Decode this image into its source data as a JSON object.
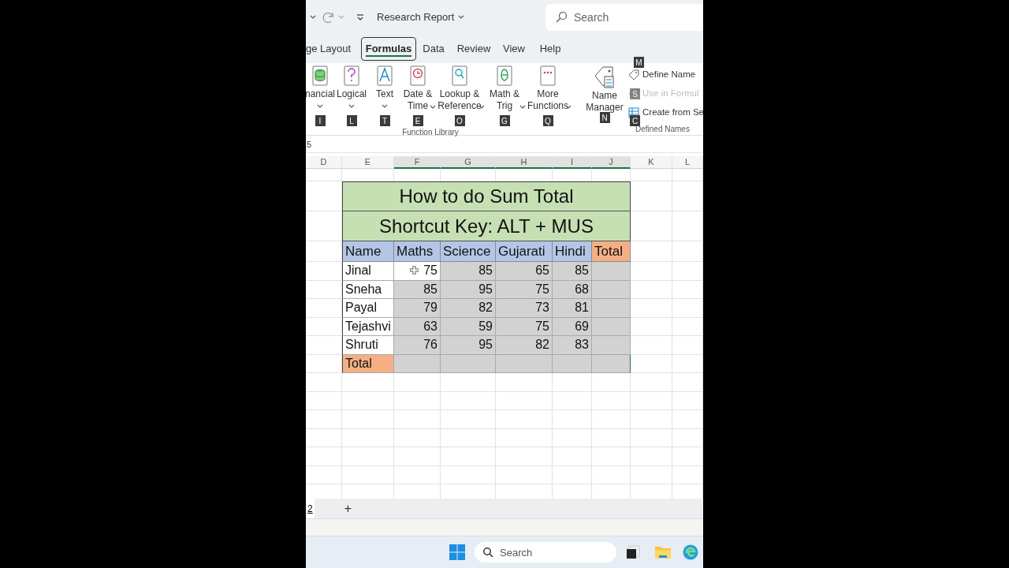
{
  "title_bar": {
    "title": "Research Report",
    "search_placeholder": "Search"
  },
  "tabs": [
    {
      "label": "ge Layout",
      "selected": false
    },
    {
      "label": "Formulas",
      "selected": true
    },
    {
      "label": "Data",
      "selected": false
    },
    {
      "label": "Review",
      "selected": false
    },
    {
      "label": "View",
      "selected": false
    },
    {
      "label": "Help",
      "selected": false
    }
  ],
  "ribbon": {
    "function_library": {
      "label": "Function Library",
      "buttons": [
        {
          "lines": [
            "nancial"
          ],
          "keytip": "I"
        },
        {
          "lines": [
            "Logical"
          ],
          "keytip": "L"
        },
        {
          "lines": [
            "Text"
          ],
          "keytip": "T"
        },
        {
          "lines": [
            "Date &",
            "Time"
          ],
          "keytip": "E"
        },
        {
          "lines": [
            "Lookup &",
            "Reference"
          ],
          "keytip": "O"
        },
        {
          "lines": [
            "Math &",
            "Trig"
          ],
          "keytip": "G"
        },
        {
          "lines": [
            "More",
            "Functions"
          ],
          "keytip": "Q"
        }
      ]
    },
    "defined_names": {
      "label": "Defined Names",
      "name_manager": {
        "lines": [
          "Name",
          "Manager"
        ],
        "keytip": "N"
      },
      "small_buttons": [
        {
          "label": "Define Name",
          "keytip": "M",
          "disabled": false
        },
        {
          "label": "Use in Formul",
          "keytip": "S",
          "disabled": true
        },
        {
          "label": "Create from Se",
          "keytip": "C",
          "disabled": false
        }
      ]
    }
  },
  "formula_bar": {
    "text": "5"
  },
  "columns": [
    {
      "label": "D",
      "selected": false
    },
    {
      "label": "E",
      "selected": false
    },
    {
      "label": "F",
      "selected": true
    },
    {
      "label": "G",
      "selected": true
    },
    {
      "label": "H",
      "selected": true
    },
    {
      "label": "I",
      "selected": true
    },
    {
      "label": "J",
      "selected": true
    },
    {
      "label": "K",
      "selected": false
    },
    {
      "label": "L",
      "selected": false
    }
  ],
  "sheet": {
    "titles": [
      "How to do Sum Total",
      "Shortcut Key: ALT + MUS"
    ],
    "headers": [
      {
        "label": "Name",
        "kind": "name"
      },
      {
        "label": "Maths",
        "kind": "subject"
      },
      {
        "label": "Science",
        "kind": "subject"
      },
      {
        "label": "Gujarati",
        "kind": "subject"
      },
      {
        "label": "Hindi",
        "kind": "subject"
      },
      {
        "label": "Total",
        "kind": "total"
      }
    ],
    "rows": [
      {
        "name": "Jinal",
        "cells": [
          {
            "value": "75",
            "active": true
          },
          {
            "value": "85",
            "active": false
          },
          {
            "value": "65",
            "active": false
          },
          {
            "value": "85",
            "active": false
          }
        ]
      },
      {
        "name": "Sneha",
        "cells": [
          {
            "value": "85",
            "active": false
          },
          {
            "value": "95",
            "active": false
          },
          {
            "value": "75",
            "active": false
          },
          {
            "value": "68",
            "active": false
          }
        ]
      },
      {
        "name": "Payal",
        "cells": [
          {
            "value": "79",
            "active": false
          },
          {
            "value": "82",
            "active": false
          },
          {
            "value": "73",
            "active": false
          },
          {
            "value": "81",
            "active": false
          }
        ]
      },
      {
        "name": "Tejashvi",
        "cells": [
          {
            "value": "63",
            "active": false
          },
          {
            "value": "59",
            "active": false
          },
          {
            "value": "75",
            "active": false
          },
          {
            "value": "69",
            "active": false
          }
        ]
      },
      {
        "name": "Shruti",
        "cells": [
          {
            "value": "76",
            "active": false
          },
          {
            "value": "95",
            "active": false
          },
          {
            "value": "82",
            "active": false
          },
          {
            "value": "83",
            "active": false
          }
        ]
      }
    ],
    "total_row": {
      "label": "Total"
    }
  },
  "sheet_tabs": {
    "tab": "2",
    "add": "+"
  },
  "taskbar": {
    "search_placeholder": "Search"
  }
}
